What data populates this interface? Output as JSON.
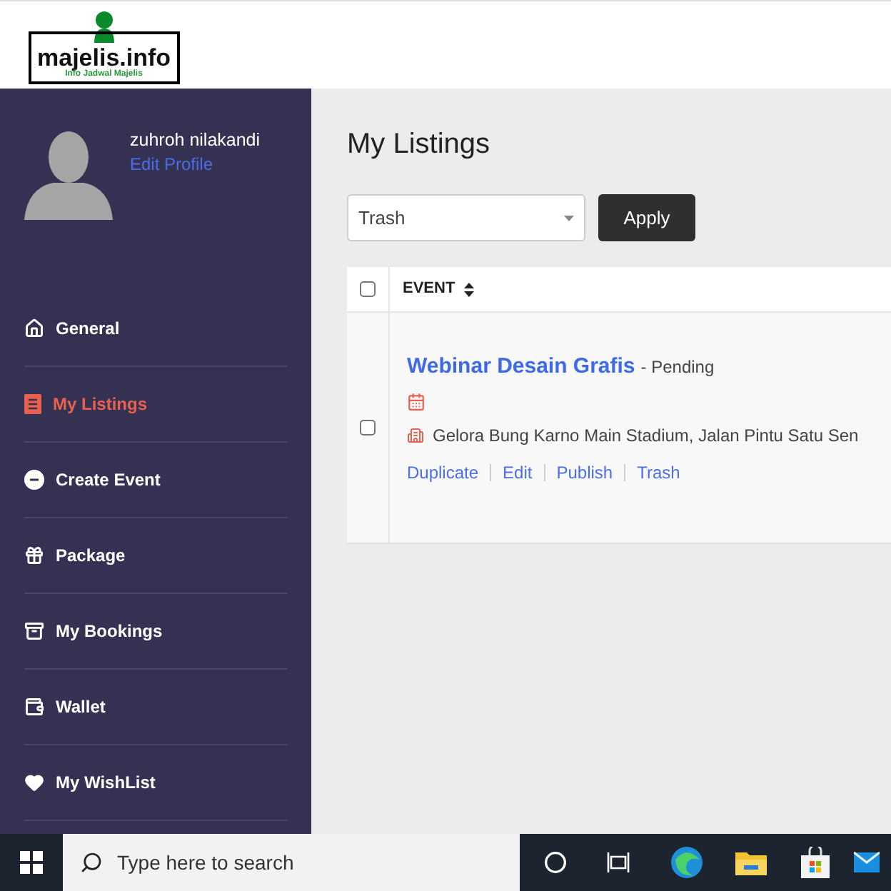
{
  "logo": {
    "title": "majelis.info",
    "tagline": "Info Jadwal Majelis"
  },
  "profile": {
    "name": "zuhroh nilakandi",
    "edit_link": "Edit Profile"
  },
  "sidebar": {
    "items": [
      {
        "label": "General",
        "selected": false
      },
      {
        "label": "My Listings",
        "selected": true
      },
      {
        "label": "Create Event",
        "selected": false
      },
      {
        "label": "Package",
        "selected": false
      },
      {
        "label": "My Bookings",
        "selected": false
      },
      {
        "label": "Wallet",
        "selected": false
      },
      {
        "label": "My WishList",
        "selected": false
      }
    ]
  },
  "page_title": "My Listings",
  "bulk_action": {
    "value": "Trash",
    "apply_button": "Apply"
  },
  "table": {
    "columns": [
      {
        "label": "EVENT",
        "checked": false
      }
    ],
    "rows": [
      {
        "checked": false,
        "title": "Webinar Desain Grafis",
        "status": "- Pending",
        "location": "Gelora Bung Karno Main Stadium, Jalan Pintu Satu Sen",
        "actions": [
          "Duplicate",
          "Edit",
          "Publish",
          "Trash"
        ]
      }
    ]
  },
  "taskbar": {
    "search_placeholder": "Type here to search"
  }
}
